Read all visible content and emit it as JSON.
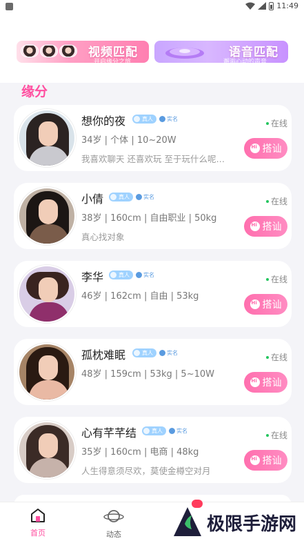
{
  "status_bar": {
    "time": "11:49"
  },
  "banners": {
    "video": {
      "title": "视频匹配",
      "subtitle": "开启缘分之旅"
    },
    "voice": {
      "title": "语音匹配",
      "subtitle": "邂逅心动的声音"
    }
  },
  "section_title": "缘分",
  "badges": {
    "real": "真人",
    "verified": "实名"
  },
  "online_label": "在线",
  "chat_label": "搭讪",
  "users": [
    {
      "name": "想你的夜",
      "info": "34岁 | 个体 | 10~20W",
      "desc": "我喜欢聊天 还喜欢玩 至于玩什么呢…"
    },
    {
      "name": "小倩",
      "info": "38岁 | 160cm | 自由职业 | 50kg",
      "desc": "真心找对象"
    },
    {
      "name": "李华",
      "info": "46岁 | 162cm | 自由 | 53kg",
      "desc": ""
    },
    {
      "name": "孤枕难眠",
      "info": "48岁 | 159cm | 53kg | 5~10W",
      "desc": ""
    },
    {
      "name": "心有芊芊结",
      "info": "35岁 | 160cm | 电商 | 48kg",
      "desc": "人生得意须尽欢，莫使金樽空对月"
    }
  ],
  "nav": {
    "home": "首页",
    "feed": "动态"
  },
  "watermark": "极限手游网",
  "colors": {
    "accent": "#ff4fa0",
    "online": "#23c55e",
    "chat_btn": "#ff6fae"
  }
}
